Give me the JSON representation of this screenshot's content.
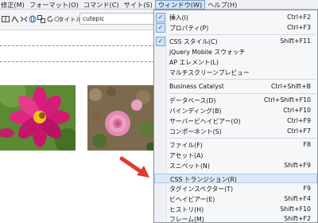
{
  "menubar": {
    "items": [
      {
        "label": "修正(M)"
      },
      {
        "label": "フォーマット(O)"
      },
      {
        "label": "コマンド(C)"
      },
      {
        "label": "サイト(S)"
      },
      {
        "label": "ウィンドウ(W)"
      },
      {
        "label": "ヘルプ(H)"
      }
    ],
    "active_index": 4
  },
  "toolbar": {
    "title_label": "タイトル：",
    "title_value": "cutepic",
    "icons": [
      "split-view-icon",
      "design-view-icon",
      "code-nav-icon",
      "globe-icon",
      "compare-icon",
      "refresh-icon",
      "file-management-icon"
    ]
  },
  "window_menu": {
    "items": [
      {
        "label": "挿入(I)",
        "shortcut": "Ctrl+F2",
        "checked": true
      },
      {
        "label": "プロパティ(P)",
        "shortcut": "Ctrl+F3",
        "checked": true
      },
      {
        "label": "CSS スタイル(C)",
        "shortcut": "Shift+F11",
        "checked": true
      },
      {
        "label": "jQuery Mobile スウォッチ",
        "shortcut": "",
        "checked": false
      },
      {
        "label": "AP エレメント(L)",
        "shortcut": "",
        "checked": false
      },
      {
        "label": "マルチスクリーンプレビュー",
        "shortcut": "",
        "checked": false
      },
      {
        "label": "Business Catalyst",
        "shortcut": "Ctrl+Shift+B",
        "checked": false
      },
      {
        "label": "データベース(D)",
        "shortcut": "Ctrl+Shift+F10",
        "checked": false
      },
      {
        "label": "バインディング(B)",
        "shortcut": "Ctrl+F10",
        "checked": false
      },
      {
        "label": "サーバービヘイビアー(O)",
        "shortcut": "Ctrl+F9",
        "checked": false
      },
      {
        "label": "コンポーネント(S)",
        "shortcut": "Ctrl+F7",
        "checked": false
      },
      {
        "label": "ファイル(F)",
        "shortcut": "F8",
        "checked": false
      },
      {
        "label": "アセット(A)",
        "shortcut": "",
        "checked": false
      },
      {
        "label": "スニペット(N)",
        "shortcut": "Shift+F9",
        "checked": false
      },
      {
        "label": "CSS トランジション(R)",
        "shortcut": "",
        "checked": false,
        "highlighted": true
      },
      {
        "label": "タグインスペクター(T)",
        "shortcut": "F9",
        "checked": false
      },
      {
        "label": "ビヘイビアー(E)",
        "shortcut": "Shift+F4",
        "checked": false
      },
      {
        "label": "ヒストリ(H)",
        "shortcut": "Shift+F10",
        "checked": false
      },
      {
        "label": "フレーム(M)",
        "shortcut": "Shift+F2",
        "checked": false
      }
    ]
  },
  "colors": {
    "arrow": "#e23b2e",
    "highlight": "#dbe9f7",
    "check_box": "#cfe3f7"
  }
}
